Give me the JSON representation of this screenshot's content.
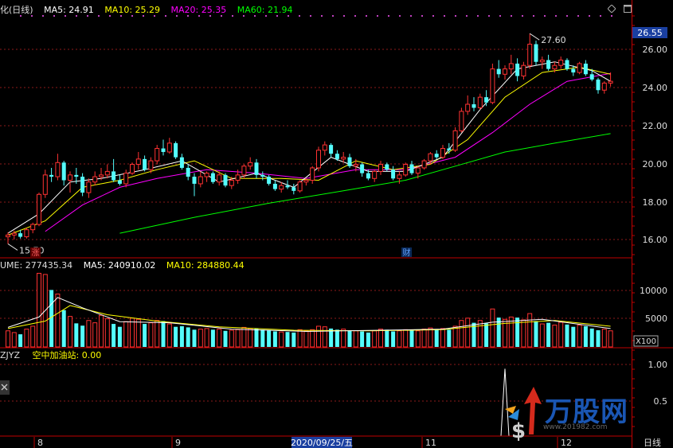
{
  "header": {
    "title": "化(日线)",
    "ma5": "MA5: 24.91",
    "ma10": "MA10: 25.29",
    "ma20": "MA20: 25.35",
    "ma60": "MA60: 21.94"
  },
  "volume_header": {
    "volume": "UME: 277435.34",
    "ma5": "MA5: 240910.02",
    "ma10": "MA10: 284880.44",
    "unit": "X100"
  },
  "indicator_header": {
    "name": "ZJYZ",
    "field": "空中加油站: 0.00"
  },
  "current_price": "26.55",
  "high_label": "27.60",
  "low_label": "15.70",
  "markers": {
    "zhang": "涨",
    "cai": "财"
  },
  "date_axis": {
    "m8": "8",
    "m9": "9",
    "selected_date": "2020/09/25/五",
    "m11": "11",
    "m12": "12",
    "period": "日线"
  },
  "watermark": {
    "text": "万股网",
    "url": "www.201982.com"
  },
  "colors": {
    "up": "#ff3232",
    "down": "#54fcfc",
    "ma5": "#ffffff",
    "ma10": "#ffff00",
    "ma20": "#ff00ff",
    "ma60": "#00ff00",
    "grid": "#8c1a1a",
    "axis": "#c00000"
  },
  "chart_data": [
    {
      "type": "candlestick",
      "title": "化(日线)",
      "ylim": [
        15,
        28
      ],
      "yticks": [
        "16.00",
        "18.00",
        "20.00",
        "22.00",
        "24.00",
        "26.00"
      ],
      "ohlc": [
        [
          16.1,
          16.35,
          15.7,
          16.2
        ],
        [
          16.2,
          16.45,
          15.95,
          16.3
        ],
        [
          16.3,
          16.5,
          16.0,
          16.1
        ],
        [
          16.1,
          16.6,
          16.0,
          16.5
        ],
        [
          16.5,
          16.9,
          16.3,
          16.8
        ],
        [
          16.8,
          18.6,
          16.7,
          18.5
        ],
        [
          18.5,
          19.9,
          18.3,
          19.6
        ],
        [
          19.6,
          20.0,
          19.2,
          19.5
        ],
        [
          19.5,
          20.8,
          19.3,
          20.3
        ],
        [
          20.3,
          20.4,
          19.0,
          19.3
        ],
        [
          19.3,
          19.8,
          18.6,
          19.6
        ],
        [
          19.6,
          20.0,
          19.1,
          19.5
        ],
        [
          19.5,
          19.7,
          18.4,
          18.6
        ],
        [
          18.6,
          19.4,
          18.3,
          19.2
        ],
        [
          19.2,
          19.8,
          19.0,
          19.5
        ],
        [
          19.5,
          20.0,
          19.3,
          19.6
        ],
        [
          19.6,
          20.2,
          19.4,
          19.8
        ],
        [
          19.8,
          20.5,
          19.2,
          19.3
        ],
        [
          19.3,
          19.6,
          19.0,
          19.1
        ],
        [
          19.1,
          19.9,
          18.9,
          19.7
        ],
        [
          19.7,
          20.3,
          19.6,
          20.2
        ],
        [
          20.2,
          20.9,
          19.9,
          20.5
        ],
        [
          20.5,
          20.7,
          19.8,
          19.9
        ],
        [
          19.9,
          20.6,
          19.7,
          20.4
        ],
        [
          20.4,
          21.3,
          20.2,
          21.1
        ],
        [
          21.1,
          21.6,
          20.7,
          20.9
        ],
        [
          20.9,
          21.7,
          20.8,
          21.4
        ],
        [
          21.4,
          21.5,
          20.5,
          20.6
        ],
        [
          20.6,
          20.8,
          19.9,
          20.0
        ],
        [
          20.0,
          20.2,
          19.3,
          19.5
        ],
        [
          19.5,
          19.7,
          18.4,
          19.1
        ],
        [
          19.1,
          19.8,
          18.9,
          19.5
        ],
        [
          19.5,
          19.8,
          19.2,
          19.7
        ],
        [
          19.7,
          19.8,
          19.1,
          19.2
        ],
        [
          19.2,
          19.8,
          19.0,
          19.6
        ],
        [
          19.6,
          19.7,
          18.9,
          19.0
        ],
        [
          19.0,
          19.5,
          18.8,
          19.3
        ],
        [
          19.3,
          19.9,
          19.1,
          19.6
        ],
        [
          19.6,
          20.2,
          19.4,
          20.1
        ],
        [
          20.1,
          20.6,
          19.9,
          20.3
        ],
        [
          20.3,
          20.5,
          19.4,
          19.6
        ],
        [
          19.6,
          19.8,
          19.3,
          19.5
        ],
        [
          19.5,
          19.6,
          19.0,
          19.1
        ],
        [
          19.1,
          19.3,
          18.7,
          18.8
        ],
        [
          18.8,
          19.2,
          18.6,
          19.0
        ],
        [
          19.0,
          19.3,
          18.8,
          18.9
        ],
        [
          18.9,
          19.1,
          18.5,
          18.7
        ],
        [
          18.7,
          19.3,
          18.6,
          19.2
        ],
        [
          19.2,
          19.4,
          19.0,
          19.3
        ],
        [
          19.3,
          20.1,
          19.1,
          20.0
        ],
        [
          20.0,
          21.2,
          19.8,
          21.0
        ],
        [
          21.0,
          21.5,
          20.7,
          21.3
        ],
        [
          21.3,
          21.4,
          20.6,
          20.8
        ],
        [
          20.8,
          21.0,
          20.4,
          20.5
        ],
        [
          20.5,
          20.9,
          20.3,
          20.6
        ],
        [
          20.6,
          20.8,
          20.0,
          20.1
        ],
        [
          20.1,
          20.5,
          19.8,
          20.2
        ],
        [
          20.2,
          20.3,
          19.5,
          19.7
        ],
        [
          19.7,
          19.9,
          19.3,
          19.4
        ],
        [
          19.4,
          19.9,
          19.2,
          19.8
        ],
        [
          19.8,
          20.4,
          19.6,
          20.2
        ],
        [
          20.2,
          20.3,
          19.8,
          19.9
        ],
        [
          19.9,
          20.1,
          19.3,
          19.4
        ],
        [
          19.4,
          19.8,
          19.1,
          19.6
        ],
        [
          19.6,
          20.3,
          19.5,
          20.2
        ],
        [
          20.2,
          20.4,
          19.6,
          19.7
        ],
        [
          19.7,
          20.1,
          19.4,
          20.0
        ],
        [
          20.0,
          20.5,
          19.9,
          20.4
        ],
        [
          20.4,
          20.9,
          20.2,
          20.8
        ],
        [
          20.8,
          21.0,
          20.5,
          20.6
        ],
        [
          20.6,
          21.3,
          20.5,
          21.1
        ],
        [
          21.1,
          21.4,
          20.8,
          21.0
        ],
        [
          21.0,
          22.3,
          20.9,
          22.1
        ],
        [
          22.1,
          23.4,
          22.0,
          23.2
        ],
        [
          23.2,
          24.1,
          23.0,
          23.6
        ],
        [
          23.6,
          24.0,
          23.2,
          23.4
        ],
        [
          23.4,
          24.2,
          23.3,
          24.0
        ],
        [
          24.0,
          24.4,
          23.5,
          23.7
        ],
        [
          23.7,
          25.9,
          23.6,
          25.6
        ],
        [
          25.6,
          26.1,
          25.1,
          25.3
        ],
        [
          25.3,
          25.8,
          25.0,
          25.6
        ],
        [
          25.6,
          26.4,
          25.3,
          25.9
        ],
        [
          25.9,
          26.2,
          24.9,
          25.2
        ],
        [
          25.2,
          26.0,
          25.0,
          25.8
        ],
        [
          25.8,
          27.6,
          25.6,
          27.0
        ],
        [
          27.0,
          27.2,
          25.8,
          26.0
        ],
        [
          26.0,
          26.3,
          25.6,
          26.1
        ],
        [
          26.1,
          26.4,
          25.5,
          25.6
        ],
        [
          25.6,
          26.0,
          25.4,
          25.8
        ],
        [
          25.8,
          26.3,
          25.6,
          26.1
        ],
        [
          26.1,
          26.2,
          25.5,
          25.6
        ],
        [
          25.6,
          25.8,
          25.2,
          25.4
        ],
        [
          25.4,
          26.0,
          25.3,
          25.9
        ],
        [
          25.9,
          26.1,
          25.2,
          25.3
        ],
        [
          25.3,
          25.6,
          24.9,
          25.0
        ],
        [
          25.0,
          25.1,
          24.2,
          24.4
        ],
        [
          24.4,
          24.9,
          24.2,
          24.8
        ],
        [
          24.8,
          25.4,
          24.6,
          24.9
        ]
      ],
      "ma5": [
        [
          0,
          16.3
        ],
        [
          5,
          17.4
        ],
        [
          10,
          19.2
        ],
        [
          15,
          19.4
        ],
        [
          22,
          19.9
        ],
        [
          28,
          20.4
        ],
        [
          34,
          19.2
        ],
        [
          40,
          19.7
        ],
        [
          46,
          18.9
        ],
        [
          52,
          20.6
        ],
        [
          58,
          19.8
        ],
        [
          64,
          19.8
        ],
        [
          70,
          20.6
        ],
        [
          76,
          23.3
        ],
        [
          82,
          25.6
        ],
        [
          88,
          26.0
        ],
        [
          94,
          25.5
        ],
        [
          97,
          24.9
        ]
      ],
      "ma10": [
        [
          0,
          16.2
        ],
        [
          6,
          17.0
        ],
        [
          12,
          18.9
        ],
        [
          18,
          19.3
        ],
        [
          24,
          19.9
        ],
        [
          30,
          20.4
        ],
        [
          36,
          19.4
        ],
        [
          44,
          19.4
        ],
        [
          50,
          19.3
        ],
        [
          56,
          20.4
        ],
        [
          62,
          19.9
        ],
        [
          68,
          20.2
        ],
        [
          74,
          21.6
        ],
        [
          80,
          24.0
        ],
        [
          86,
          25.4
        ],
        [
          92,
          25.7
        ],
        [
          97,
          25.3
        ]
      ],
      "ma20": [
        [
          6,
          16.4
        ],
        [
          12,
          17.9
        ],
        [
          18,
          18.9
        ],
        [
          24,
          19.4
        ],
        [
          32,
          19.9
        ],
        [
          40,
          19.7
        ],
        [
          48,
          19.4
        ],
        [
          56,
          19.9
        ],
        [
          64,
          19.9
        ],
        [
          72,
          20.6
        ],
        [
          78,
          22.0
        ],
        [
          84,
          23.6
        ],
        [
          90,
          24.9
        ],
        [
          97,
          25.35
        ]
      ],
      "ma60": [
        [
          18,
          16.3
        ],
        [
          30,
          17.2
        ],
        [
          42,
          18.0
        ],
        [
          54,
          18.7
        ],
        [
          64,
          19.3
        ],
        [
          72,
          20.1
        ],
        [
          80,
          20.9
        ],
        [
          88,
          21.4
        ],
        [
          97,
          21.94
        ]
      ]
    },
    {
      "type": "bar",
      "title": "VOLUME",
      "ylim": [
        0,
        13000
      ],
      "yticks": [
        "5000",
        "10000"
      ],
      "values": [
        2800,
        2500,
        2200,
        3100,
        3600,
        12800,
        12600,
        9900,
        9200,
        6400,
        5300,
        4100,
        3700,
        4600,
        4200,
        5500,
        4900,
        4000,
        3500,
        4400,
        5000,
        4800,
        4000,
        4200,
        4600,
        4500,
        4000,
        3500,
        3600,
        3400,
        3000,
        3100,
        3200,
        3000,
        3100,
        2800,
        2900,
        3000,
        3400,
        3200,
        3200,
        3000,
        2900,
        2700,
        2600,
        2600,
        2500,
        3000,
        2800,
        3000,
        3600,
        3500,
        3200,
        3000,
        3100,
        2900,
        2800,
        2700,
        2500,
        2800,
        3100,
        3000,
        2700,
        2800,
        3000,
        2900,
        2800,
        3100,
        3300,
        3000,
        3200,
        3000,
        3600,
        4600,
        5000,
        4200,
        4600,
        4100,
        6600,
        5100,
        4800,
        5200,
        5100,
        4700,
        5800,
        4500,
        4000,
        4200,
        3800,
        4300,
        3900,
        3500,
        3800,
        3600,
        3200,
        2900,
        3100,
        2800
      ],
      "ma5": [
        [
          0,
          3400
        ],
        [
          5,
          5200
        ],
        [
          8,
          8600
        ],
        [
          12,
          6800
        ],
        [
          18,
          4400
        ],
        [
          26,
          4200
        ],
        [
          36,
          3100
        ],
        [
          48,
          2700
        ],
        [
          60,
          2900
        ],
        [
          70,
          3100
        ],
        [
          78,
          4300
        ],
        [
          86,
          4800
        ],
        [
          97,
          3200
        ]
      ],
      "ma10": [
        [
          0,
          3200
        ],
        [
          6,
          4500
        ],
        [
          10,
          7200
        ],
        [
          16,
          5600
        ],
        [
          24,
          4500
        ],
        [
          34,
          3500
        ],
        [
          46,
          2900
        ],
        [
          58,
          2800
        ],
        [
          70,
          3000
        ],
        [
          80,
          4100
        ],
        [
          88,
          4600
        ],
        [
          97,
          3600
        ]
      ]
    },
    {
      "type": "line",
      "title": "ZJYZ",
      "ylim": [
        0,
        1.1
      ],
      "yticks": [
        "0.5",
        "1.00"
      ],
      "values_note_free": true,
      "signal_index": 80,
      "signal_value": 1.0
    }
  ]
}
